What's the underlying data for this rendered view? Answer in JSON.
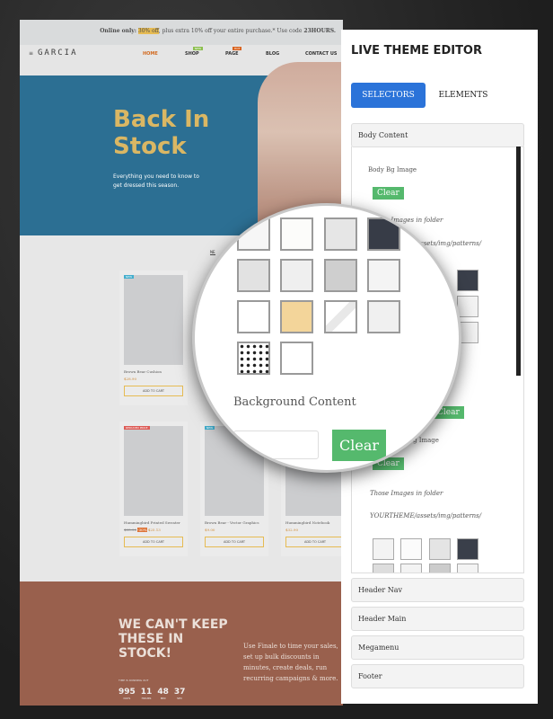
{
  "site": {
    "promo": {
      "lead": "Online only:",
      "highlight": "30% off",
      "rest": ", plus extra 10% off your entire purchase.* Use code ",
      "code": "23HOURS."
    },
    "logo": "GARCIA",
    "nav": [
      {
        "label": "HOME"
      },
      {
        "label": "SHOP",
        "badge": "NEW"
      },
      {
        "label": "PAGE",
        "badge": "HOT"
      },
      {
        "label": "BLOG"
      },
      {
        "label": "CONTACT US"
      }
    ],
    "hero": {
      "title_line1": "Back In",
      "title_line2": "Stock",
      "subtitle": "Everything you need to know to get dressed this season."
    },
    "tab_partial": "NE",
    "products": [
      {
        "name": "Brown Bear Cushion",
        "price": "$28.90",
        "tag": "NEW",
        "button": "ADD TO CART"
      },
      {
        "name": "Hummingbird Printed Sweater",
        "old_price": "$35.90",
        "discount": "-30%",
        "price": "$25.13",
        "tag": "NEW",
        "tag2": "REDUCED PRICE",
        "button": "ADD TO CART"
      },
      {
        "name": "Brown Bear - Vector Graphics",
        "price": "$9.00",
        "tag": "NEW",
        "button": "ADD TO CART"
      },
      {
        "name": "Hummingbird Notebook",
        "price": "$32.90",
        "button": "ADD TO CART"
      }
    ],
    "countdown": {
      "title": "WE CAN'T KEEP THESE IN STOCK!",
      "running": "TIME IS RUNNING OUT",
      "units": [
        {
          "v": "995",
          "l": "DAYS"
        },
        {
          "v": "11",
          "l": "HOURS"
        },
        {
          "v": "48",
          "l": "MIN"
        },
        {
          "v": "37",
          "l": "SEC"
        }
      ],
      "text": "Use Finale to time your sales, set up bulk discounts in minutes, create deals, run recurring campaigns & more."
    }
  },
  "editor": {
    "title": "LIVE THEME EDITOR",
    "tabs": {
      "selectors": "SELECTORS",
      "elements": "ELEMENTS"
    },
    "sections": {
      "body_content": "Body Content",
      "header_nav": "Header Nav",
      "header_main": "Header Main",
      "megamenu": "Megamenu",
      "footer": "Footer"
    },
    "body_bg_image": "Body Bg Image",
    "clear": "Clear",
    "folder_note": "Those Images in folder",
    "folder_path": "YOURTHEME/assets/img/patterns/",
    "bg_content": "Background Content",
    "content_bg_partial": "g Image"
  },
  "colors": {
    "accent": "#2b73d9",
    "clear": "#55b96d",
    "hero": "#0f5c84",
    "hero_title": "#d5ad4f",
    "countdown": "#8b4a35"
  }
}
